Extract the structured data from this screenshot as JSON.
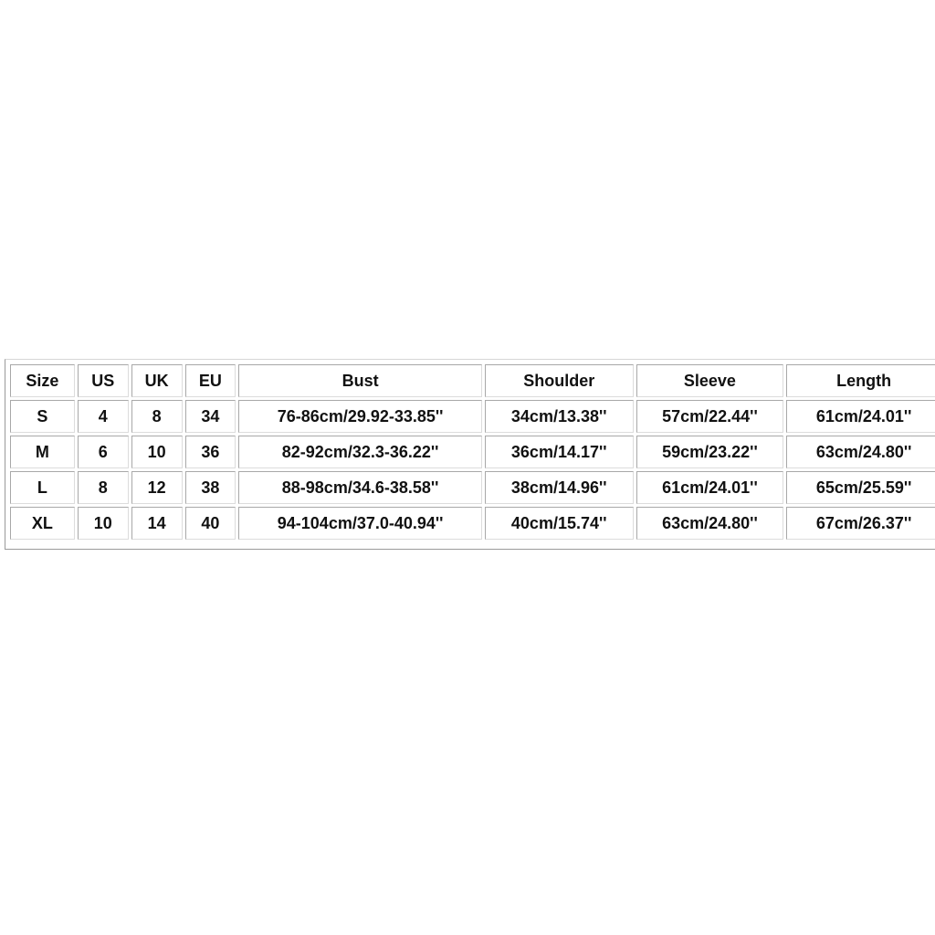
{
  "size_chart": {
    "headers": [
      "Size",
      "US",
      "UK",
      "EU",
      "Bust",
      "Shoulder",
      "Sleeve",
      "Length"
    ],
    "rows": [
      [
        "S",
        "4",
        "8",
        "34",
        "76-86cm/29.92-33.85''",
        "34cm/13.38''",
        "57cm/22.44''",
        "61cm/24.01''"
      ],
      [
        "M",
        "6",
        "10",
        "36",
        "82-92cm/32.3-36.22''",
        "36cm/14.17''",
        "59cm/23.22''",
        "63cm/24.80''"
      ],
      [
        "L",
        "8",
        "12",
        "38",
        "88-98cm/34.6-38.58''",
        "38cm/14.96''",
        "61cm/24.01''",
        "65cm/25.59''"
      ],
      [
        "XL",
        "10",
        "14",
        "40",
        "94-104cm/37.0-40.94''",
        "40cm/15.74''",
        "63cm/24.80''",
        "67cm/26.37''"
      ]
    ]
  }
}
